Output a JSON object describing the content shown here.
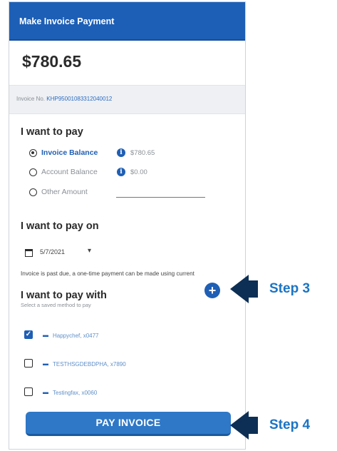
{
  "panel": {
    "title": "Make Invoice Payment",
    "amount": "$780.65",
    "invoice_label": "Invoice No.",
    "invoice_number": "KHP95001083312040012"
  },
  "pay_amount": {
    "heading": "I want to pay",
    "options": [
      {
        "label": "Invoice Balance",
        "value": "$780.65",
        "selected": true
      },
      {
        "label": "Account Balance",
        "value": "$0.00",
        "selected": false
      },
      {
        "label": "Other Amount",
        "value": "",
        "selected": false
      }
    ],
    "info_glyph": "i"
  },
  "pay_date": {
    "heading": "I want to pay on",
    "date": "5/7/2021",
    "caret": "▾",
    "note": "Invoice is past due, a one-time payment can be made using current"
  },
  "pay_method": {
    "heading": "I want to pay with",
    "subtext": "Select a saved method to pay",
    "add_glyph": "+",
    "methods": [
      {
        "name": "Happychef, x0477",
        "checked": true
      },
      {
        "name": "TESTHSGDEBDPHA, x7890",
        "checked": false
      },
      {
        "name": "Testingfax, x0060",
        "checked": false
      }
    ]
  },
  "pay_button": "PAY INVOICE",
  "annotations": {
    "step3": "Step 3",
    "step4": "Step 4",
    "arrow_color": "#0d2f55",
    "step_color": "#1b74c4"
  }
}
